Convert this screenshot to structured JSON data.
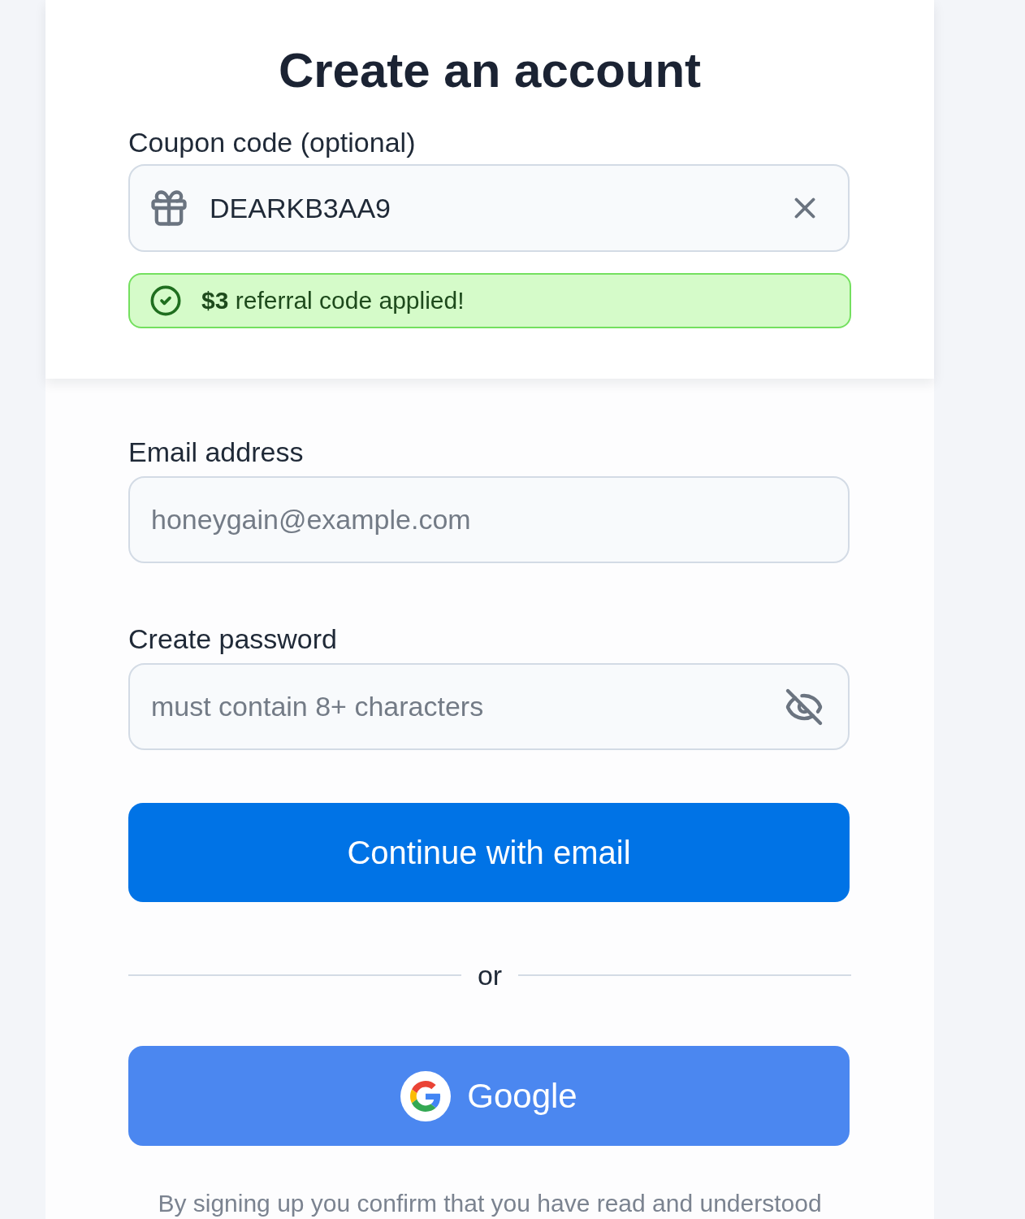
{
  "title": "Create an account",
  "coupon": {
    "label": "Coupon code (optional)",
    "value": "DEARKB3AA9"
  },
  "coupon_status": {
    "kind": "success",
    "text": "**$3** referral code applied!"
  },
  "email": {
    "label": "Email address",
    "placeholder": "honeygain@example.com"
  },
  "password": {
    "label": "Create password",
    "placeholder": "must contain 8+ characters",
    "show_password": false
  },
  "email_button": {
    "label": "Continue with email"
  },
  "divider": {
    "label": "or"
  },
  "google_button": {
    "label": "Google"
  },
  "legal": "By signing up you confirm that you have read and understood"
}
